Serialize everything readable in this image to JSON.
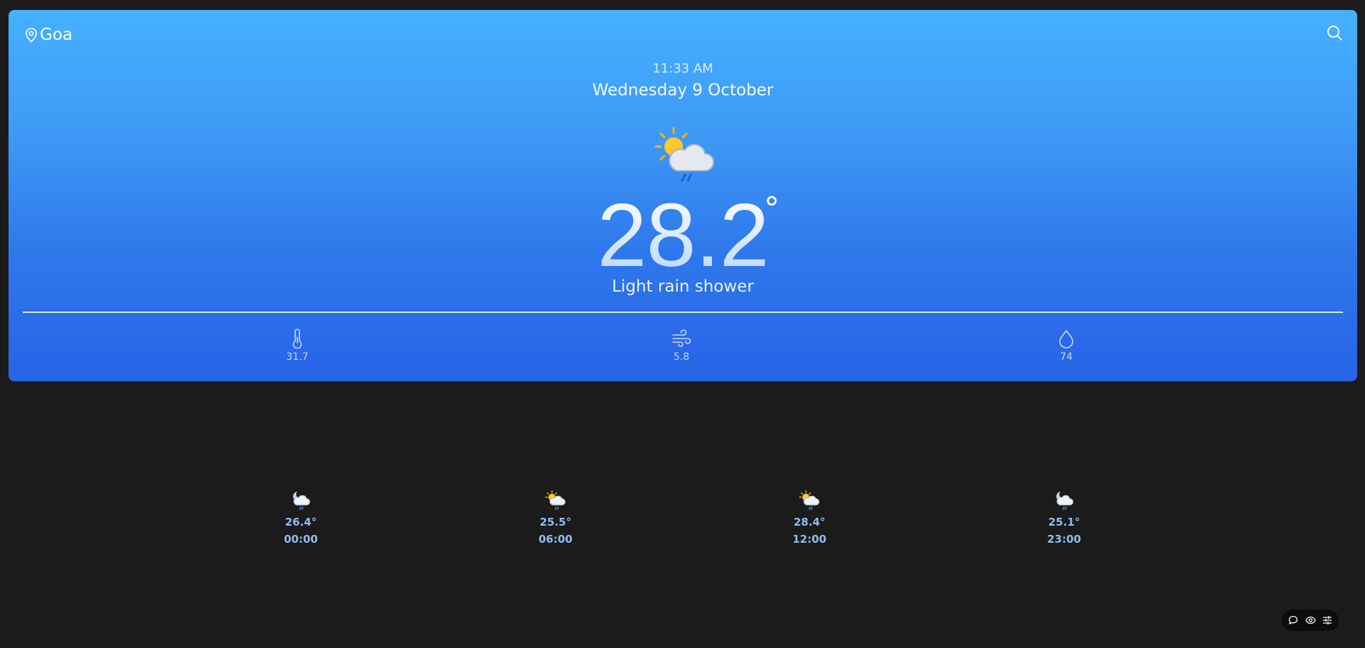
{
  "location": {
    "name": "Goa",
    "icon": "map-pin-icon"
  },
  "search": {
    "icon": "search-icon"
  },
  "current": {
    "time": "11:33 AM",
    "date": "Wednesday 9 October",
    "temperature": "28.2",
    "degree_symbol": "°",
    "condition": "Light rain shower",
    "icon": "partly-cloudy-rain-icon"
  },
  "stats": [
    {
      "icon": "thermometer-icon",
      "value": "31.7"
    },
    {
      "icon": "wind-icon",
      "value": "5.8"
    },
    {
      "icon": "droplet-icon",
      "value": "74"
    }
  ],
  "forecast": [
    {
      "icon": "night-cloud-rain-icon",
      "temp": "26.4°",
      "time": "00:00"
    },
    {
      "icon": "day-cloud-rain-icon",
      "temp": "25.5°",
      "time": "06:00"
    },
    {
      "icon": "day-cloud-rain-icon",
      "temp": "28.4°",
      "time": "12:00"
    },
    {
      "icon": "night-cloud-rain-icon",
      "temp": "25.1°",
      "time": "23:00"
    }
  ],
  "toolbar": {
    "items": [
      "comment-icon",
      "eye-icon",
      "sliders-icon"
    ]
  },
  "colors": {
    "page_background": "#1b1b1b",
    "card_gradient_top": "#45b1ff",
    "card_gradient_bottom": "#2763e8",
    "forecast_text": "#8ebcf4"
  }
}
